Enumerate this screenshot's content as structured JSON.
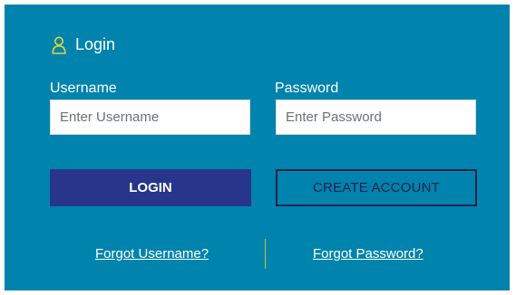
{
  "header": {
    "icon": "user-icon",
    "title": "Login"
  },
  "form": {
    "username_label": "Username",
    "username_placeholder": "Enter Username",
    "username_value": "",
    "password_label": "Password",
    "password_placeholder": "Enter Password",
    "password_value": ""
  },
  "buttons": {
    "login_label": "LOGIN",
    "create_label": "CREATE ACCOUNT"
  },
  "links": {
    "forgot_username": "Forgot Username?",
    "forgot_password": "Forgot Password?"
  },
  "colors": {
    "panel": "#0083ad",
    "login_button": "#27368a",
    "create_border": "#14214f",
    "icon_accent": "#e6d43c",
    "divider": "#c9b94a"
  }
}
